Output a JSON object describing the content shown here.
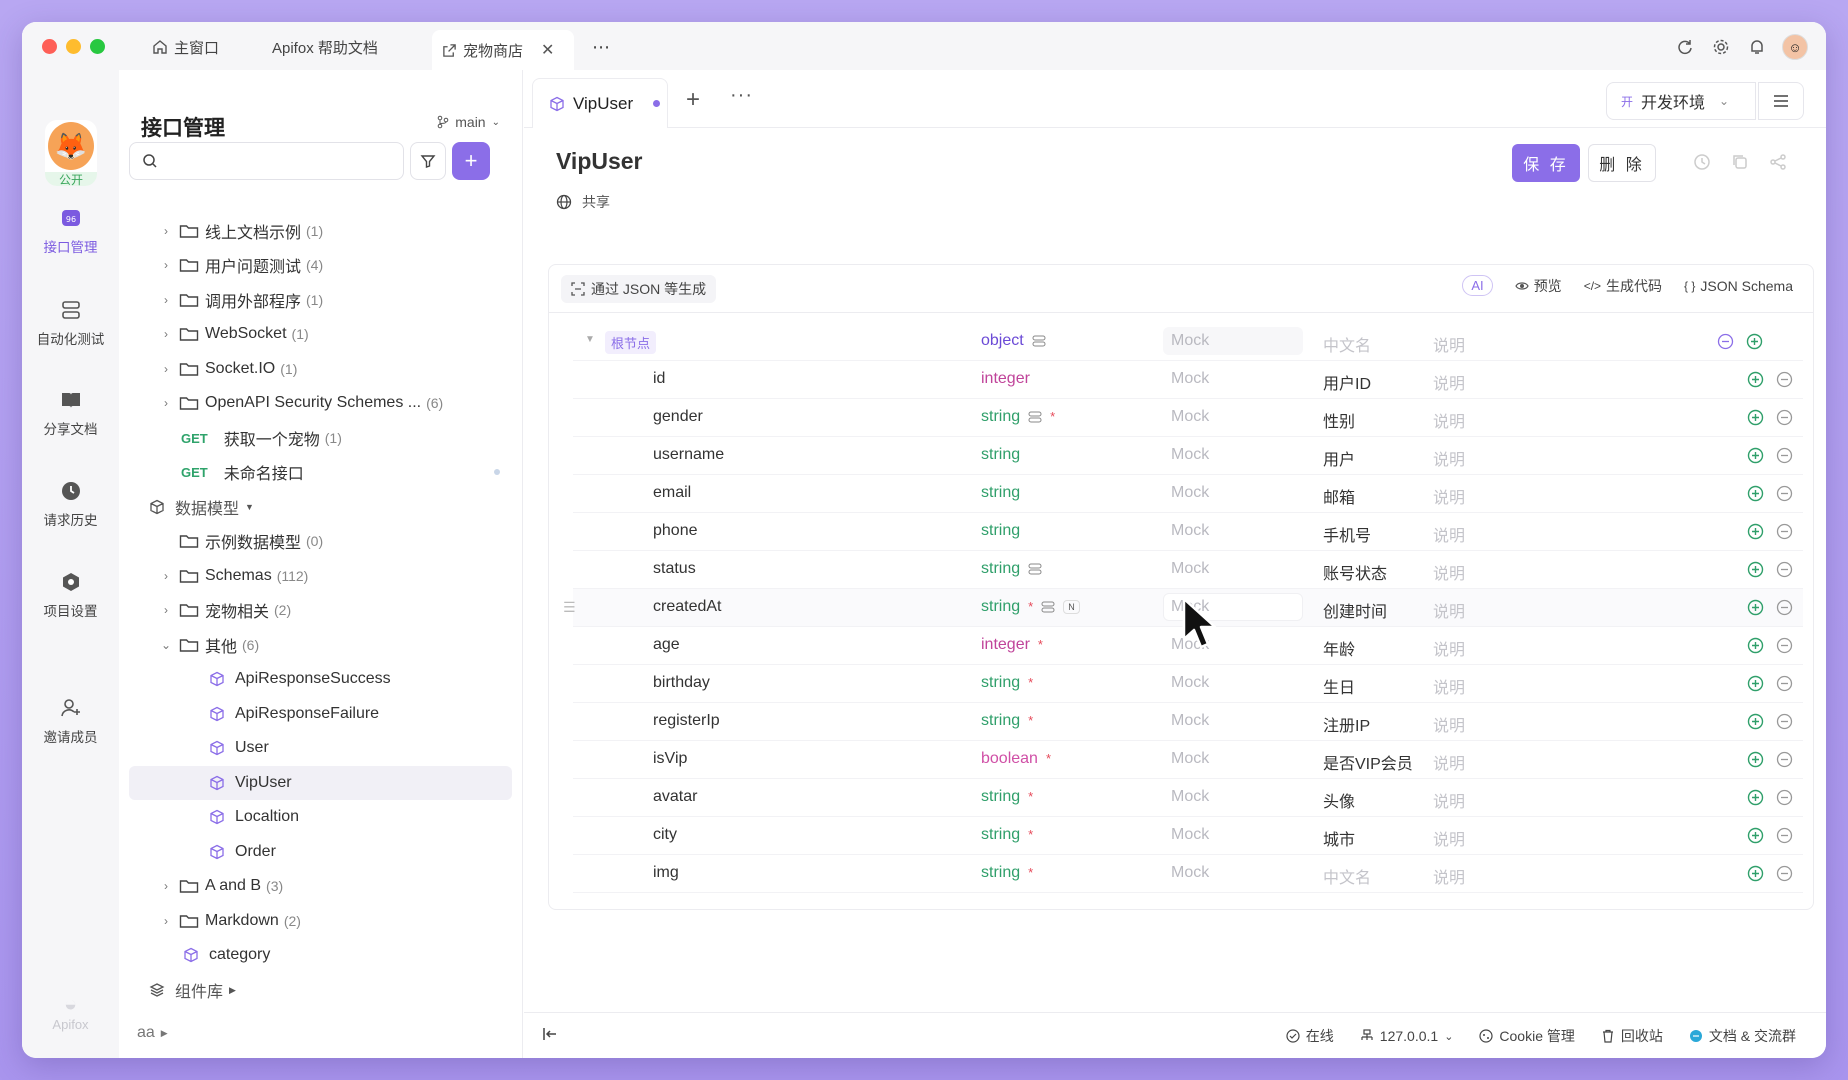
{
  "window_tabs": [
    {
      "label": "主窗口",
      "icon": "home-icon"
    },
    {
      "label": "Apifox 帮助文档"
    },
    {
      "label": "宠物商店",
      "icon": "external-link-icon",
      "active": true
    }
  ],
  "rail": {
    "logo_badge": "公开",
    "items": [
      {
        "label": "接口管理",
        "icon": "api-icon",
        "active": true
      },
      {
        "label": "自动化测试",
        "icon": "automation-icon"
      },
      {
        "label": "分享文档",
        "icon": "book-icon"
      },
      {
        "label": "请求历史",
        "icon": "clock-icon"
      },
      {
        "label": "项目设置",
        "icon": "settings-icon"
      },
      {
        "label": "邀请成员",
        "icon": "invite-user-icon"
      }
    ],
    "brand": "Apifox"
  },
  "tree": {
    "title": "接口管理",
    "branch": "main",
    "rows": [
      {
        "kind": "folder",
        "label": "线上文档示例",
        "count": "(1)"
      },
      {
        "kind": "folder",
        "label": "用户问题测试",
        "count": "(4)"
      },
      {
        "kind": "folder",
        "label": "调用外部程序",
        "count": "(1)"
      },
      {
        "kind": "folder",
        "label": "WebSocket",
        "count": "(1)"
      },
      {
        "kind": "folder",
        "label": "Socket.IO",
        "count": "(1)"
      },
      {
        "kind": "folder",
        "label": "OpenAPI Security Schemes ...",
        "count": "(6)"
      },
      {
        "kind": "get",
        "method": "GET",
        "label": "获取一个宠物",
        "count": "(1)"
      },
      {
        "kind": "get",
        "method": "GET",
        "label": "未命名接口",
        "count": ""
      },
      {
        "kind": "section",
        "label": "数据模型",
        "count": ""
      },
      {
        "kind": "folder-nochev",
        "label": "示例数据模型",
        "count": "(0)"
      },
      {
        "kind": "folder",
        "label": "Schemas",
        "count": "(112)"
      },
      {
        "kind": "folder",
        "label": "宠物相关",
        "count": "(2)"
      },
      {
        "kind": "folder-open",
        "label": "其他",
        "count": "(6)"
      },
      {
        "kind": "model",
        "label": "ApiResponseSuccess",
        "count": ""
      },
      {
        "kind": "model",
        "label": "ApiResponseFailure",
        "count": ""
      },
      {
        "kind": "model",
        "label": "User",
        "count": ""
      },
      {
        "kind": "model",
        "label": "VipUser",
        "count": "",
        "selected": true
      },
      {
        "kind": "model",
        "label": "Localtion",
        "count": ""
      },
      {
        "kind": "model",
        "label": "Order",
        "count": ""
      },
      {
        "kind": "folder",
        "label": "A and B",
        "count": "(3)"
      },
      {
        "kind": "folder",
        "label": "Markdown",
        "count": "(2)"
      },
      {
        "kind": "model-top",
        "label": "category",
        "count": ""
      },
      {
        "kind": "section2",
        "label": "组件库",
        "count": ""
      },
      {
        "kind": "plain",
        "label": "aa",
        "count": ""
      }
    ]
  },
  "doc_tab": {
    "label": "VipUser"
  },
  "env": {
    "badge": "开",
    "label": "开发环境"
  },
  "schema": {
    "title": "VipUser",
    "shared_label": "共享",
    "save_label": "保 存",
    "delete_label": "删 除",
    "gen_label": "通过 JSON 等生成",
    "ai_label": "AI",
    "preview_label": "预览",
    "codegen_label": "生成代码",
    "jsonschema_label": "JSON Schema",
    "root": {
      "label": "根节点",
      "type": "object",
      "mock": "Mock",
      "cn": "中文名",
      "desc": "说明"
    },
    "fields": [
      {
        "name": "id",
        "type": "integer",
        "required": false,
        "mock": "Mock",
        "cn": "用户ID",
        "desc": "说明"
      },
      {
        "name": "gender",
        "type": "string",
        "required": true,
        "meta": true,
        "mock": "Mock",
        "cn": "性别",
        "desc": "说明"
      },
      {
        "name": "username",
        "type": "string",
        "required": false,
        "mock": "Mock",
        "cn": "用户",
        "desc": "说明"
      },
      {
        "name": "email",
        "type": "string",
        "required": false,
        "mock": "Mock",
        "cn": "邮箱",
        "desc": "说明"
      },
      {
        "name": "phone",
        "type": "string",
        "required": false,
        "mock": "Mock",
        "cn": "手机号",
        "desc": "说明"
      },
      {
        "name": "status",
        "type": "string",
        "required": false,
        "meta": true,
        "mock": "Mock",
        "cn": "账号状态",
        "desc": "说明"
      },
      {
        "name": "createdAt",
        "type": "string",
        "required": true,
        "meta": true,
        "nullable": "N",
        "mock": "Mock",
        "cn": "创建时间",
        "desc": "说明"
      },
      {
        "name": "age",
        "type": "integer",
        "required": true,
        "mock": "Mock",
        "cn": "年龄",
        "desc": "说明"
      },
      {
        "name": "birthday",
        "type": "string",
        "required": true,
        "mock": "Mock",
        "cn": "生日",
        "desc": "说明"
      },
      {
        "name": "registerIp",
        "type": "string",
        "required": true,
        "mock": "Mock",
        "cn": "注册IP",
        "desc": "说明"
      },
      {
        "name": "isVip",
        "type": "boolean",
        "required": true,
        "mock": "Mock",
        "cn": "是否VIP会员",
        "desc": "说明"
      },
      {
        "name": "avatar",
        "type": "string",
        "required": true,
        "mock": "Mock",
        "cn": "头像",
        "desc": "说明"
      },
      {
        "name": "city",
        "type": "string",
        "required": true,
        "mock": "Mock",
        "cn": "城市",
        "desc": "说明"
      },
      {
        "name": "img",
        "type": "string",
        "required": true,
        "mock": "Mock",
        "cn": "中文名",
        "cn_placeholder": true,
        "desc": "说明"
      }
    ]
  },
  "statusbar": {
    "online": "在线",
    "host": "127.0.0.1",
    "cookie": "Cookie 管理",
    "recycle": "回收站",
    "community": "文档 & 交流群"
  },
  "colors": {
    "accent": "#8b6ee8",
    "string": "#2f9f6a",
    "integer": "#c0449a",
    "get": "#2fa36b"
  }
}
